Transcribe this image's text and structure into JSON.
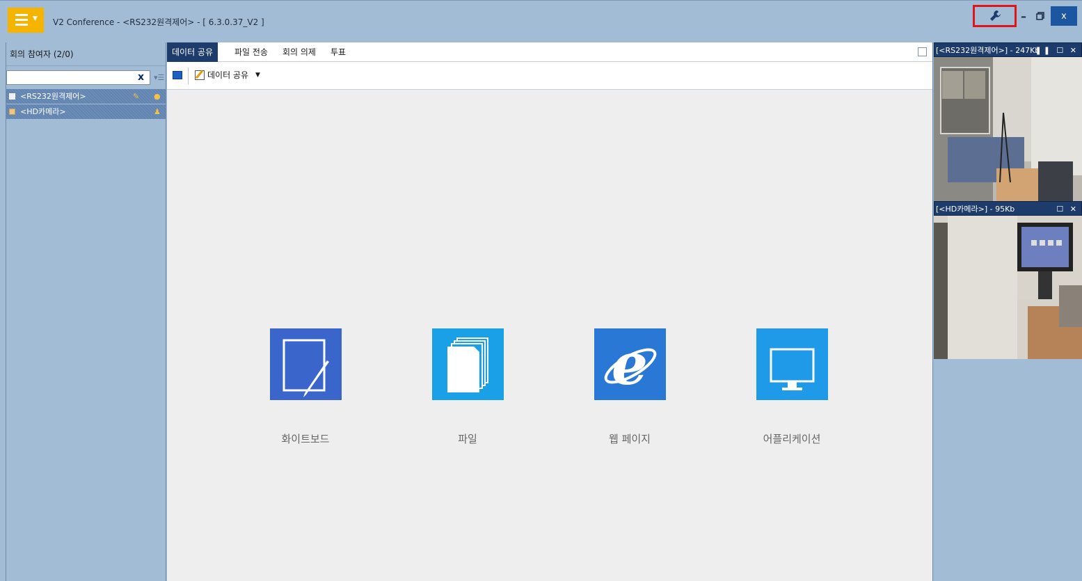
{
  "window": {
    "title": "V2 Conference - <RS232원격제어> - [ 6.3.0.37_V2 ]",
    "minimize": "–",
    "close": "x"
  },
  "participants": {
    "header": "회의 참여자 (2/0)",
    "search_value": "",
    "search_clear": "x",
    "items": [
      {
        "label": "<RS232원격제어>"
      },
      {
        "label": "<HD카메라>"
      }
    ]
  },
  "tabs": [
    {
      "label": "데이터 공유",
      "active": true
    },
    {
      "label": "파일 전송",
      "active": false
    },
    {
      "label": "회의 의제",
      "active": false
    },
    {
      "label": "투표",
      "active": false
    }
  ],
  "toolbar": {
    "share_label": "데이터 공유",
    "share_caret": "▼"
  },
  "tiles": [
    {
      "label": "화이트보드",
      "color": "#3a66cc",
      "icon": "whiteboard-icon"
    },
    {
      "label": "파일",
      "color": "#1aa0e6",
      "icon": "file-icon"
    },
    {
      "label": "웹 페이지",
      "color": "#2a78d6",
      "icon": "ie-icon"
    },
    {
      "label": "어플리케이션",
      "color": "#1e9ae8",
      "icon": "monitor-icon"
    }
  ],
  "videos": [
    {
      "title": "[<RS232원격제어>] - 247Kb"
    },
    {
      "title": "[<HD카메라>] - 95Kb"
    }
  ],
  "colors": {
    "accent": "#f5b400",
    "highlight": "#e0141b",
    "header_dark": "#1d3b6b"
  }
}
